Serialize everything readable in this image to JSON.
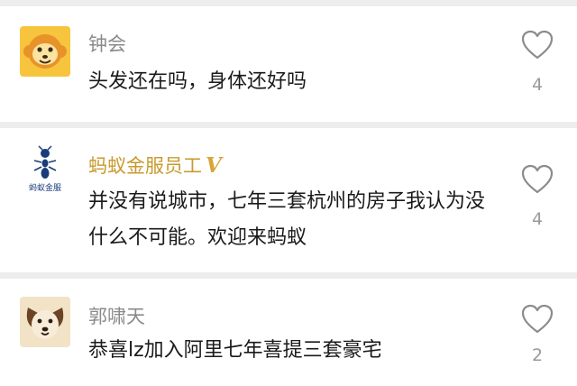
{
  "comments": [
    {
      "username": "钟会",
      "avatar_icon": "monkey-face-icon",
      "text": "头发还在吗，身体还好吗",
      "likes": "4",
      "verified": false
    },
    {
      "username": "蚂蚁金服员工",
      "verified_badge": "V",
      "avatar_icon": "ant-financial-logo-icon",
      "avatar_label": "蚂蚁金服",
      "text": "并没有说城市，七年三套杭州的房子我认为没什么不可能。欢迎来蚂蚁",
      "likes": "4",
      "verified": true
    },
    {
      "username": "郭啸天",
      "avatar_icon": "dog-face-icon",
      "text": "恭喜lz加入阿里七年喜提三套豪宅",
      "likes": "2",
      "verified": false
    }
  ],
  "colors": {
    "divider": "#ededed",
    "username": "#8a8a8a",
    "verified_name": "#c99a2c",
    "text": "#1a1a1a",
    "count": "#9a9a9a"
  }
}
